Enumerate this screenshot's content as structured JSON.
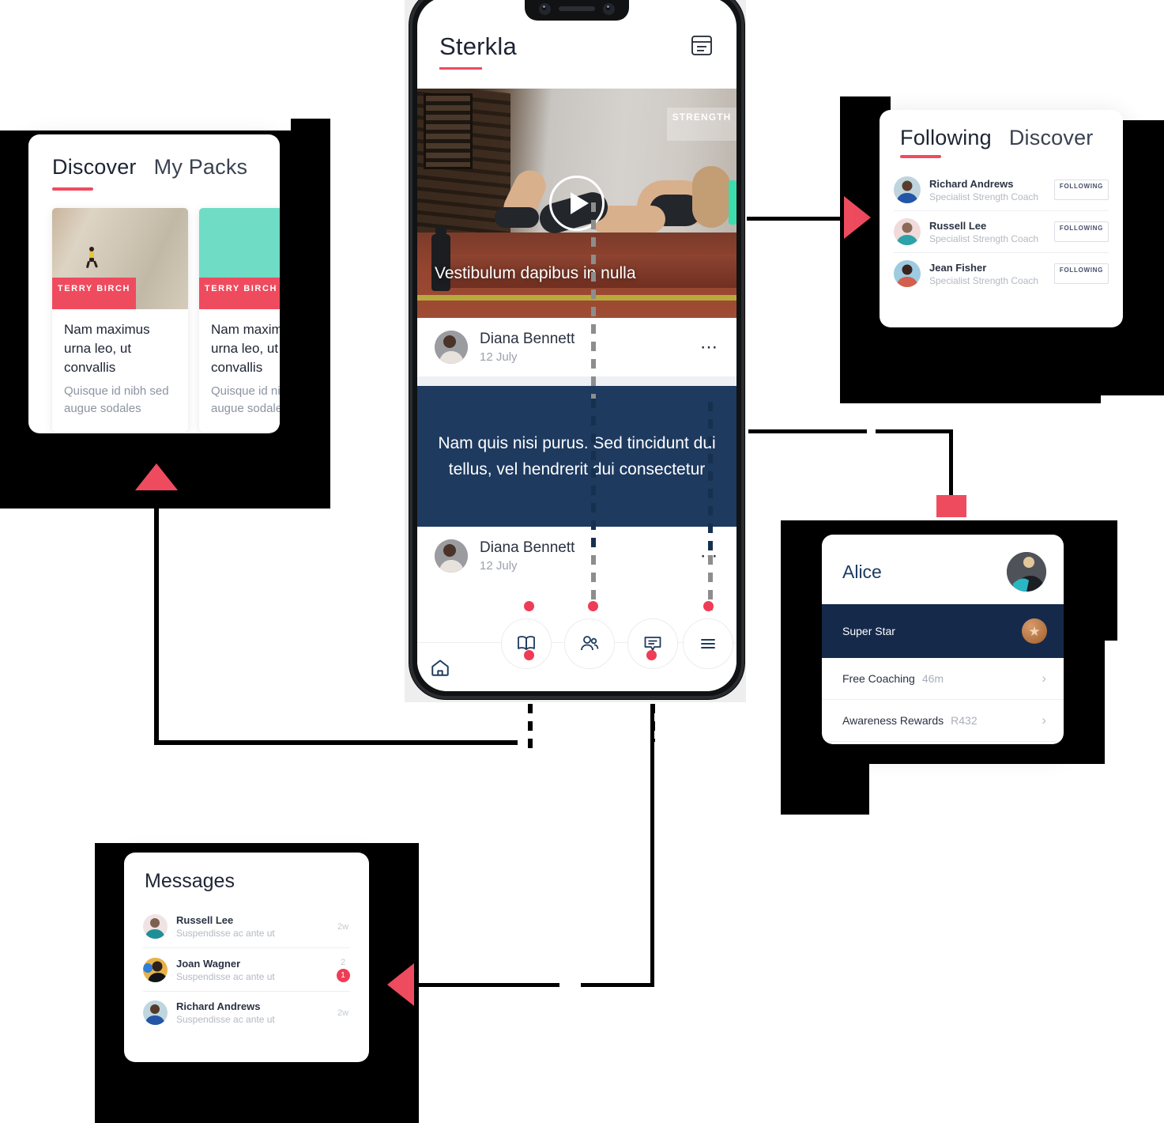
{
  "app": {
    "title": "Sterkla",
    "header_icon": "note-icon"
  },
  "hero": {
    "tag": "STRENGTH",
    "caption": "Vestibulum dapibus in nulla",
    "play_icon": "play-icon"
  },
  "posts": [
    {
      "author": "Diana Bennett",
      "date": "12 July",
      "more_icon": "more-horizontal-icon"
    },
    {
      "author": "Diana Bennett",
      "date": "12 July",
      "more_icon": "more-horizontal-icon"
    }
  ],
  "quote": {
    "text": "Nam quis nisi purus. Sed tincidunt dui tellus, vel hendrerit dui consectetur"
  },
  "bottom_nav": [
    {
      "icon": "home-icon",
      "label": "Home"
    },
    {
      "icon": "book-icon",
      "label": "Packs"
    },
    {
      "icon": "people-icon",
      "label": "Coaches"
    },
    {
      "icon": "chat-icon",
      "label": "Messages"
    },
    {
      "icon": "menu-icon",
      "label": "More"
    }
  ],
  "discover_card": {
    "tabs": [
      {
        "label": "Discover",
        "active": true
      },
      {
        "label": "My Packs",
        "active": false
      }
    ],
    "packs": [
      {
        "tag": "TERRY BIRCH",
        "title": "Nam maximus urna leo, ut convallis",
        "subtitle": "Quisque id nibh sed augue sodales"
      },
      {
        "tag": "TERRY BIRCH",
        "title": "Nam maximus urna leo, ut convallis",
        "subtitle": "Quisque id nibh sed augue sodales"
      }
    ]
  },
  "following_card": {
    "tabs": [
      {
        "label": "Following",
        "active": true
      },
      {
        "label": "Discover",
        "active": false
      }
    ],
    "coaches": [
      {
        "name": "Richard Andrews",
        "role": "Specialist Strength Coach",
        "button": "FOLLOWING"
      },
      {
        "name": "Russell Lee",
        "role": "Specialist Strength Coach",
        "button": "FOLLOWING"
      },
      {
        "name": "Jean Fisher",
        "role": "Specialist Strength Coach",
        "button": "FOLLOWING"
      }
    ]
  },
  "alice_card": {
    "name": "Alice",
    "avatar": "avatar",
    "highlight": {
      "label": "Super Star",
      "badge_icon": "star-medal-icon"
    },
    "rows": [
      {
        "label": "Free Coaching",
        "value": "46m",
        "chevron": "chevron-right-icon"
      },
      {
        "label": "Awareness Rewards",
        "value": "R432",
        "chevron": "chevron-right-icon"
      }
    ]
  },
  "messages_card": {
    "title": "Messages",
    "messages": [
      {
        "name": "Russell Lee",
        "preview": "Suspendisse ac ante ut",
        "time": "2w",
        "badge": ""
      },
      {
        "name": "Joan Wagner",
        "preview": "Suspendisse ac ante ut",
        "time": "2",
        "badge": "1"
      },
      {
        "name": "Richard Andrews",
        "preview": "Suspendisse ac ante ut",
        "time": "2w",
        "badge": ""
      }
    ]
  },
  "colors": {
    "accent": "#ef4b5f",
    "navy": "#1e3a5f",
    "navy_dark": "#15294b",
    "teal": "#6fdcc6",
    "badge_red": "#ef3c56"
  }
}
